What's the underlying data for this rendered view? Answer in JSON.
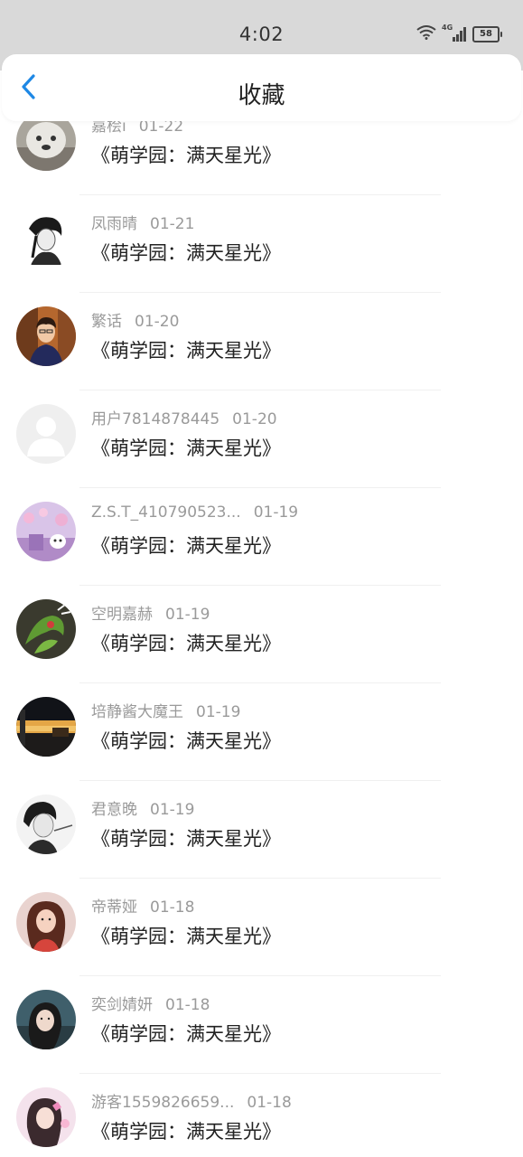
{
  "status_bar": {
    "time": "4:02",
    "network": "4G",
    "battery": "58"
  },
  "header": {
    "title": "收藏",
    "back_icon": "chevron-left-icon",
    "accent_color": "#1e88e5"
  },
  "items": [
    {
      "name": "嘉桧i",
      "date": "01-22",
      "title": "《萌学园：满天星光》"
    },
    {
      "name": "凤雨晴",
      "date": "01-21",
      "title": "《萌学园：满天星光》"
    },
    {
      "name": "繁话",
      "date": "01-20",
      "title": "《萌学园：满天星光》"
    },
    {
      "name": "用户7814878445",
      "date": "01-20",
      "title": "《萌学园：满天星光》"
    },
    {
      "name": "Z.S.T_410790523...",
      "date": "01-19",
      "title": "《萌学园：满天星光》"
    },
    {
      "name": "空明嘉赫",
      "date": "01-19",
      "title": "《萌学园：满天星光》"
    },
    {
      "name": "培静酱大魔王",
      "date": "01-19",
      "title": "《萌学园：满天星光》"
    },
    {
      "name": "君意晚",
      "date": "01-19",
      "title": "《萌学园：满天星光》"
    },
    {
      "name": "帝蒂娅",
      "date": "01-18",
      "title": "《萌学园：满天星光》"
    },
    {
      "name": "奕剑婧妍",
      "date": "01-18",
      "title": "《萌学园：满天星光》"
    },
    {
      "name": "游客1559826659...",
      "date": "01-18",
      "title": "《萌学园：满天星光》"
    }
  ]
}
